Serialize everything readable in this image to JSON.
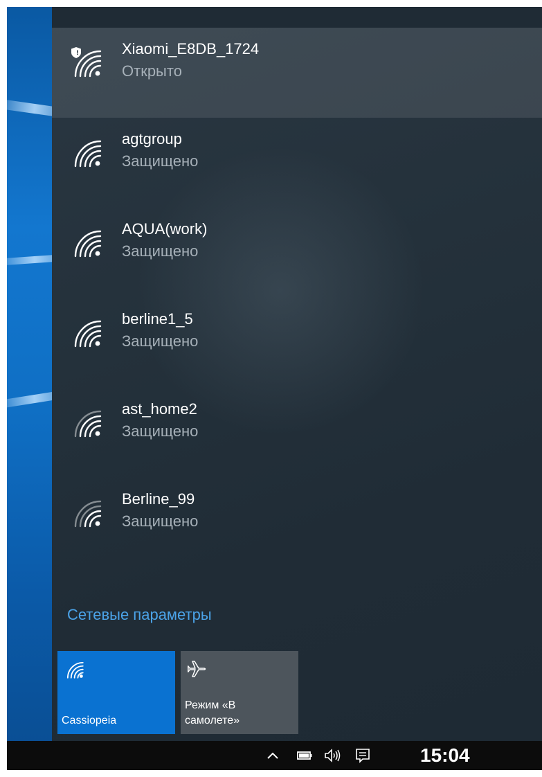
{
  "networks": [
    {
      "name": "Xiaomi_E8DB_1724",
      "status": "Открыто",
      "selected": true,
      "secured_badge": true
    },
    {
      "name": "agtgroup",
      "status": "Защищено"
    },
    {
      "name": "AQUA(work)",
      "status": "Защищено"
    },
    {
      "name": "berline1_5",
      "status": "Защищено"
    },
    {
      "name": "ast_home2",
      "status": "Защищено"
    },
    {
      "name": "Berline_99",
      "status": "Защищено"
    }
  ],
  "settings_link": "Сетевые параметры",
  "tiles": {
    "wifi": {
      "label": "Cassiopeia",
      "icon": "wifi-icon"
    },
    "airplane": {
      "label": "Режим «В\nсамолете»",
      "icon": "airplane-icon"
    }
  },
  "taskbar": {
    "clock": "15:04",
    "tray_icons": [
      "chevron-up-icon",
      "battery-icon",
      "volume-icon",
      "action-center-icon"
    ]
  },
  "colors": {
    "accent": "#0a72d1",
    "link": "#4ba3e8",
    "panel": "#24313b",
    "taskbar": "#0c0c0c"
  }
}
